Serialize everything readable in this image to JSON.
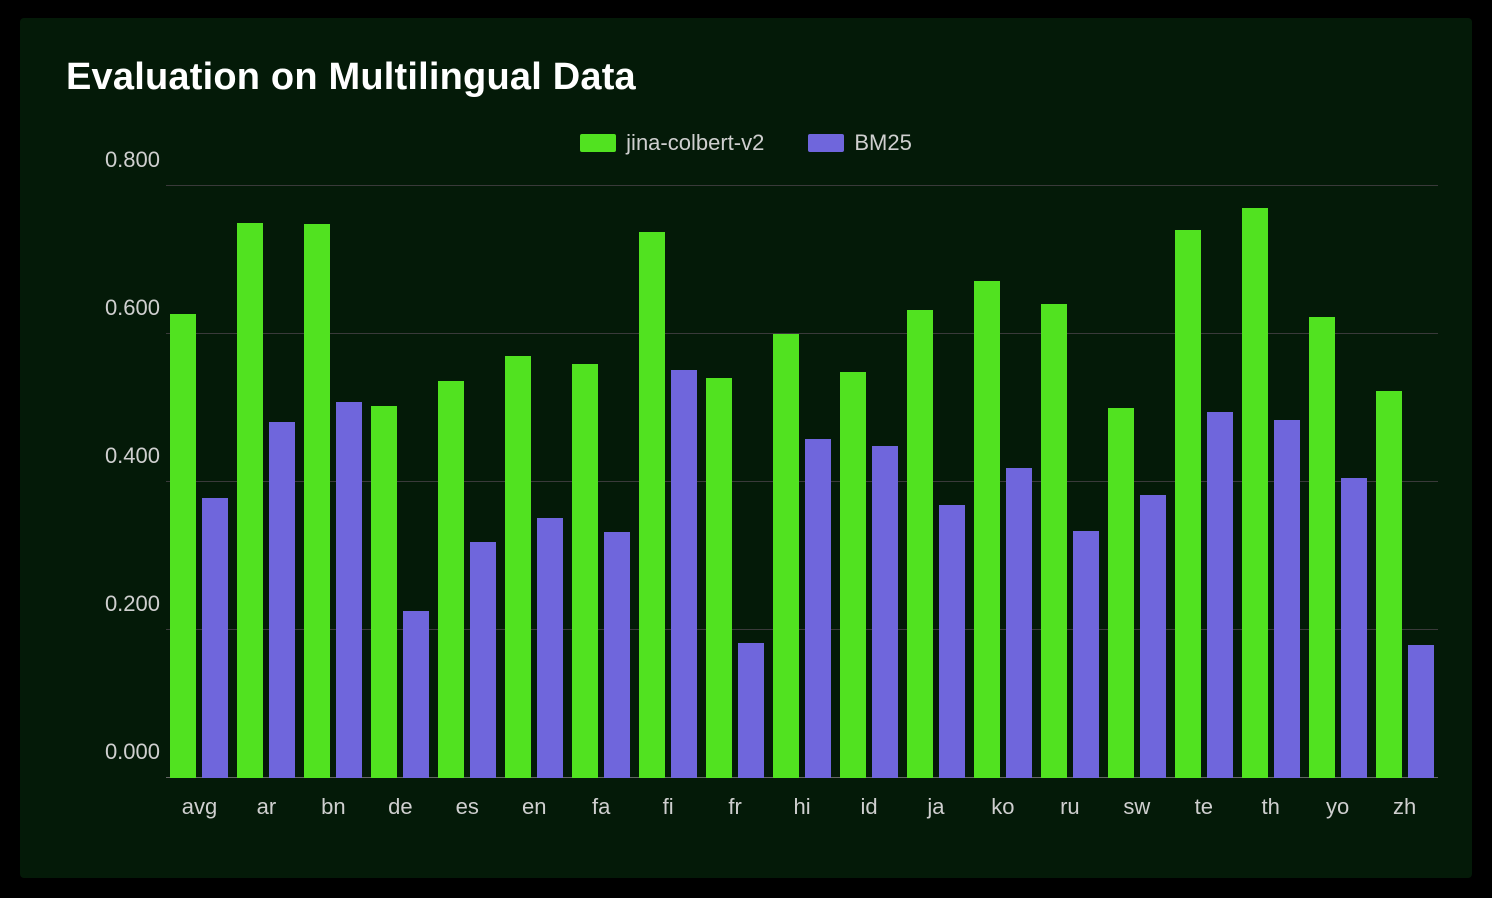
{
  "chart_data": {
    "type": "bar",
    "title": "Evaluation on Multilingual Data",
    "xlabel": "",
    "ylabel": "",
    "ylim": [
      0.0,
      0.8
    ],
    "yticks": [
      0.0,
      0.2,
      0.4,
      0.6,
      0.8
    ],
    "ytick_labels": [
      "0.000",
      "0.200",
      "0.400",
      "0.600",
      "0.800"
    ],
    "categories": [
      "avg",
      "ar",
      "bn",
      "de",
      "es",
      "en",
      "fa",
      "fi",
      "fr",
      "hi",
      "id",
      "ja",
      "ko",
      "ru",
      "sw",
      "te",
      "th",
      "yo",
      "zh"
    ],
    "series": [
      {
        "name": "jina-colbert-v2",
        "color": "#51e220",
        "values": [
          0.627,
          0.75,
          0.748,
          0.503,
          0.537,
          0.57,
          0.56,
          0.738,
          0.541,
          0.6,
          0.548,
          0.632,
          0.672,
          0.64,
          0.5,
          0.74,
          0.77,
          0.623,
          0.523
        ]
      },
      {
        "name": "BM25",
        "color": "#6f66dc",
        "values": [
          0.378,
          0.481,
          0.508,
          0.226,
          0.319,
          0.351,
          0.333,
          0.551,
          0.183,
          0.458,
          0.449,
          0.369,
          0.419,
          0.334,
          0.383,
          0.494,
          0.484,
          0.406,
          0.18
        ]
      }
    ],
    "legend_position": "top"
  }
}
